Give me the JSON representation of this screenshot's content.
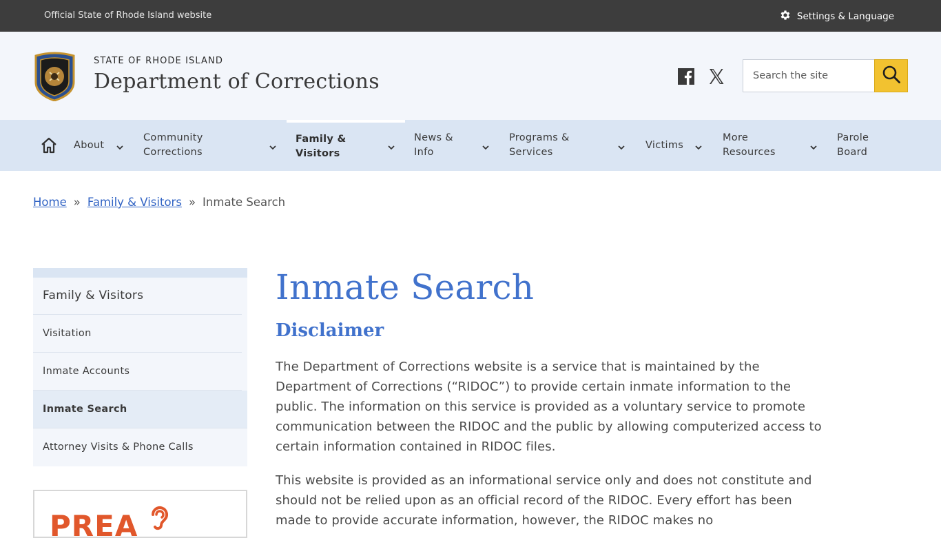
{
  "topbar": {
    "official_text": "Official State of Rhode Island website",
    "settings_label": "Settings & Language",
    "settings_icon": "gear-icon"
  },
  "header": {
    "state_name": "STATE OF RHODE ISLAND",
    "department_name": "Department of Corrections",
    "seal_icon": "ridoc-seal",
    "social": [
      {
        "name": "facebook-icon"
      },
      {
        "name": "x-twitter-icon"
      }
    ],
    "search": {
      "placeholder": "Search the site",
      "button_icon": "search-icon"
    }
  },
  "nav": {
    "home_icon": "home-icon",
    "items": [
      {
        "label": "About"
      },
      {
        "label": "Community Corrections"
      },
      {
        "label": "Family & Visitors",
        "active": true
      },
      {
        "label": "News & Info"
      },
      {
        "label": "Programs & Services"
      },
      {
        "label": "Victims"
      },
      {
        "label": "More Resources"
      },
      {
        "label": "Parole Board"
      }
    ]
  },
  "breadcrumb": {
    "home": "Home",
    "separator": "»",
    "parent": "Family & Visitors",
    "current": "Inmate Search"
  },
  "sidebar": {
    "parent": "Family & Visitors",
    "items": [
      {
        "label": "Visitation"
      },
      {
        "label": "Inmate Accounts"
      },
      {
        "label": "Inmate Search",
        "active": true
      },
      {
        "label": "Attorney Visits & Phone Calls"
      }
    ],
    "prea_label": "PREA"
  },
  "main": {
    "title": "Inmate Search",
    "subtitle": "Disclaimer",
    "paragraphs": [
      "The Department of Corrections website is a service that is maintained by the Department of Corrections (“RIDOC”) to provide certain inmate information to the public. The information on this service is provided as a voluntary service to promote communication between the RIDOC and the public by allowing computerized access to certain information contained in RIDOC files.",
      "This website is provided as an informational service only and does not constitute and should not be relied upon as an official record of the RIDOC. Every effort has been made to provide accurate information, however, the RIDOC makes no"
    ]
  },
  "colors": {
    "topbar_bg": "#3d3d3d",
    "header_bg": "#f3f6fb",
    "nav_bg": "#dae5f3",
    "accent_blue": "#4172cc",
    "link_blue": "#3163c4",
    "search_button": "#f2c230",
    "prea_orange": "#e1572b"
  }
}
